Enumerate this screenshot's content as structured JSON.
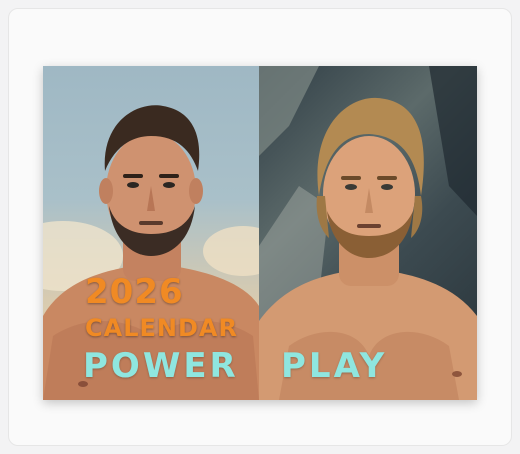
{
  "calendar": {
    "year": "2026",
    "subtitle": "CALENDAR",
    "title_left": "POWER",
    "title_right": "PLAY"
  },
  "colors": {
    "year_text": "#f08a24",
    "title_text": "#8fe6df"
  }
}
